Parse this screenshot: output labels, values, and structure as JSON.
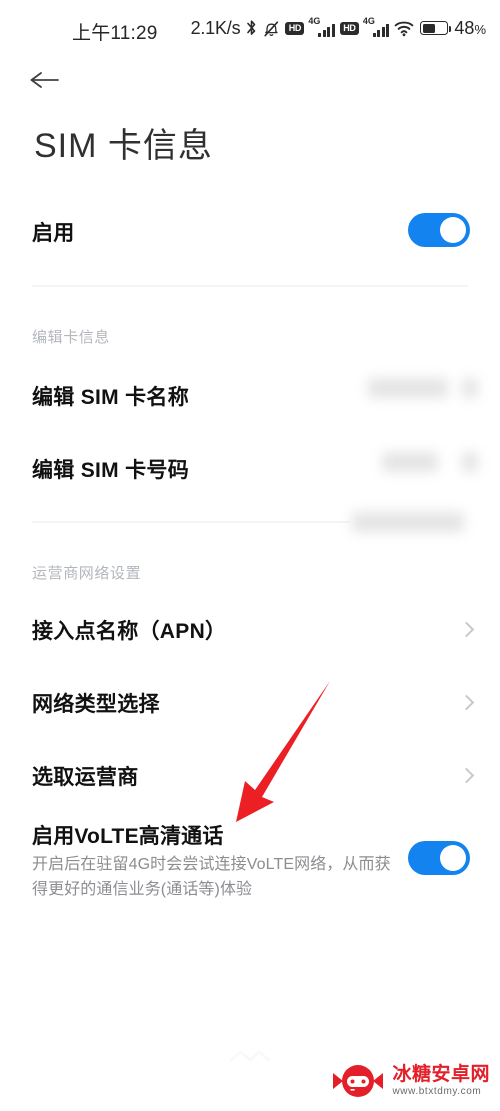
{
  "statusbar": {
    "time": "上午11:29",
    "net_speed": "2.1K/s",
    "bluetooth_icon": "bluetooth-icon",
    "silent_icon": "bell-muted-icon",
    "hd1_label": "HD",
    "sim1_net_label": "4G",
    "hd2_label": "HD",
    "sim2_net_label": "4G",
    "wifi_icon": "wifi-icon",
    "battery_percent": "48",
    "battery_unit": "%"
  },
  "header": {
    "back_icon": "back-arrow-icon",
    "title": "SIM 卡信息"
  },
  "enable_row": {
    "label": "启用",
    "toggle_state": "on"
  },
  "sections": [
    {
      "heading": "编辑卡信息",
      "items": [
        {
          "label": "编辑 SIM 卡名称",
          "value": "",
          "value_redacted": true,
          "accessory": "redacted-value"
        },
        {
          "label": "编辑 SIM 卡号码",
          "value": "",
          "value_redacted": true,
          "accessory": "redacted-value"
        }
      ]
    },
    {
      "heading": "运营商网络设置",
      "items": [
        {
          "label": "接入点名称（APN）",
          "accessory": "chevron-right"
        },
        {
          "label": "网络类型选择",
          "accessory": "chevron-right"
        },
        {
          "label": "选取运营商",
          "accessory": "chevron-right"
        }
      ]
    }
  ],
  "volte_row": {
    "title": "启用VoLTE高清通话",
    "description": "开启后在驻留4G时会尝试连接VoLTE网络，从而获得更好的通信业务(通话等)体验",
    "toggle_state": "on"
  },
  "annotation": {
    "type": "arrow",
    "color": "#ec2024",
    "points_to": "启用VoLTE高清通话"
  },
  "watermark": {
    "name": "冰糖安卓网",
    "url": "www.btxtdmy.com",
    "logo_icon": "candy-gamepad-logo-icon"
  },
  "colors": {
    "accent": "#1383f0",
    "title": "#303030",
    "label": "#111111",
    "section_heading": "#b3b7bd",
    "description": "#8d8d92",
    "divider": "#f4f4f5",
    "annotation_red": "#ec2024",
    "watermark_red": "#e3202a"
  }
}
